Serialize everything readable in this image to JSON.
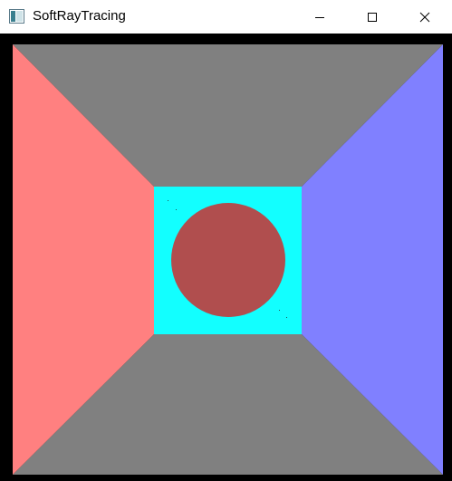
{
  "window": {
    "title": "SoftRayTracing",
    "app_icon": "app-window-icon",
    "controls": {
      "minimize_icon": "minimize-icon",
      "maximize_icon": "maximize-icon",
      "close_icon": "close-icon"
    }
  },
  "scene": {
    "colors": {
      "background": "#000000",
      "floor_ceiling": "#808080",
      "left_wall": "#ff8080",
      "right_wall": "#8080ff",
      "back_wall": "#12ffff",
      "sphere": "#b04e4e"
    }
  }
}
